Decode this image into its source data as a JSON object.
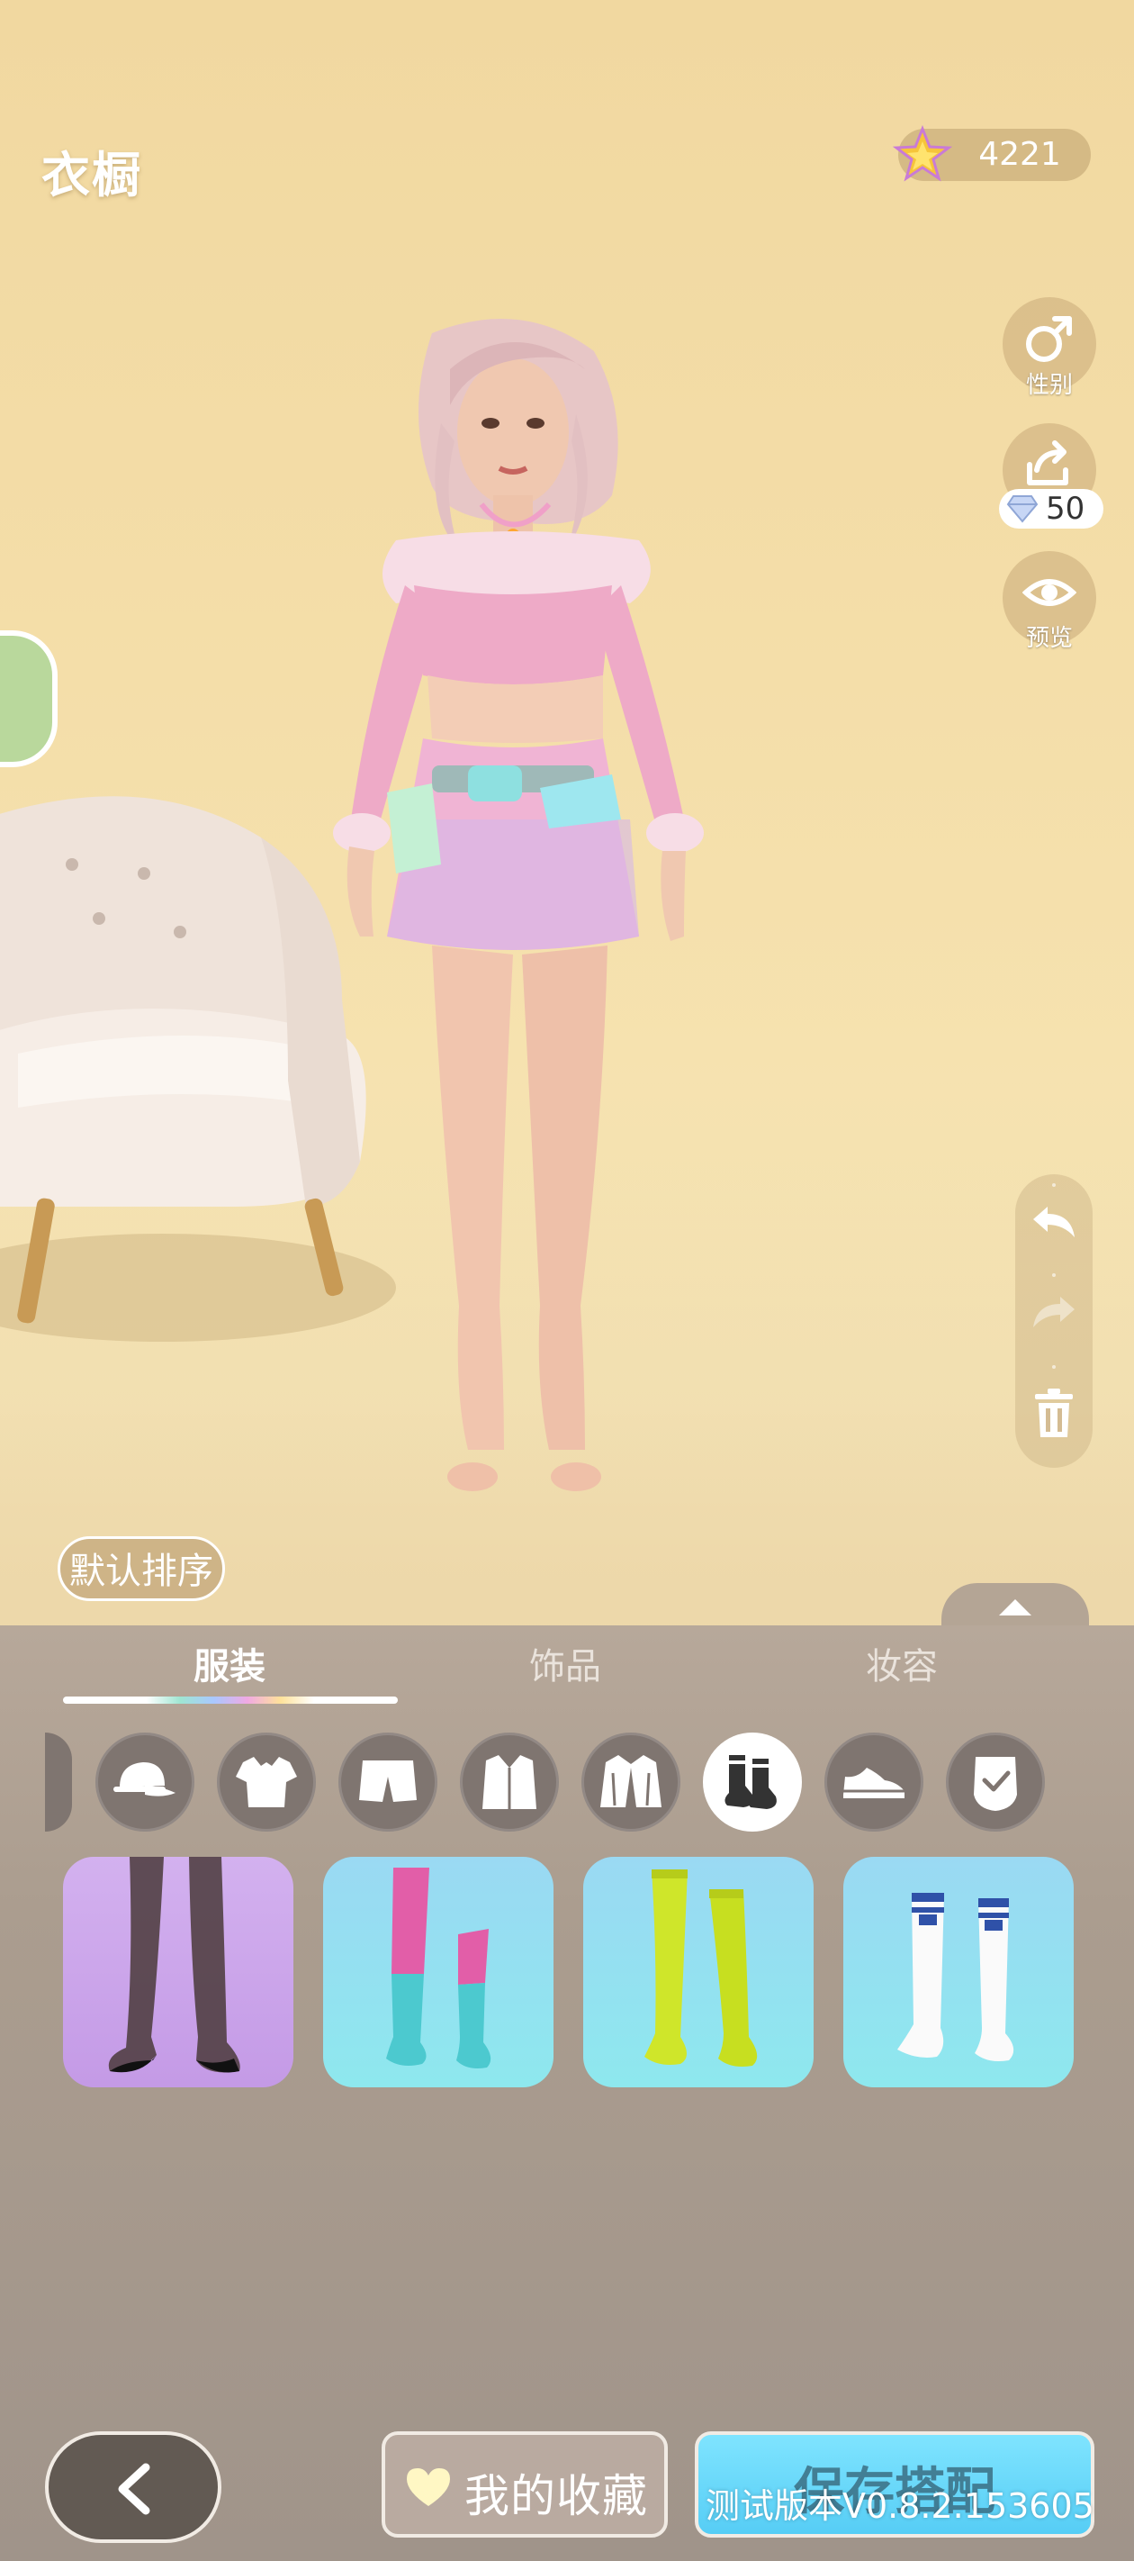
{
  "header": {
    "title": "衣橱",
    "currency": "4221",
    "currency_icon": "star-gem-icon"
  },
  "side_buttons": {
    "gender_label": "性别",
    "share_cost": "50",
    "preview_label": "预览"
  },
  "sort": {
    "label": "默认排序"
  },
  "tabs": [
    {
      "label": "服装",
      "active": true
    },
    {
      "label": "饰品",
      "active": false
    },
    {
      "label": "妆容",
      "active": false
    }
  ],
  "sub_categories": [
    {
      "icon": "hat-icon"
    },
    {
      "icon": "shirt-icon"
    },
    {
      "icon": "shorts-icon"
    },
    {
      "icon": "dress-shirt-icon"
    },
    {
      "icon": "jacket-icon"
    },
    {
      "icon": "socks-icon",
      "active": true
    },
    {
      "icon": "sneaker-icon"
    },
    {
      "icon": "glove-icon"
    }
  ],
  "items": [
    {
      "name": "black-sheer-stockings",
      "bg": "#c9a6ee"
    },
    {
      "name": "pink-cyan-knee-socks",
      "bg": "#97dbf0"
    },
    {
      "name": "neon-green-stockings",
      "bg": "#97dbf0"
    },
    {
      "name": "white-sport-socks",
      "bg": "#97dbf0"
    }
  ],
  "footer": {
    "favorites_label": "我的收藏",
    "save_label": "保存搭配",
    "version": "测试版本V0.8.2.153605"
  }
}
